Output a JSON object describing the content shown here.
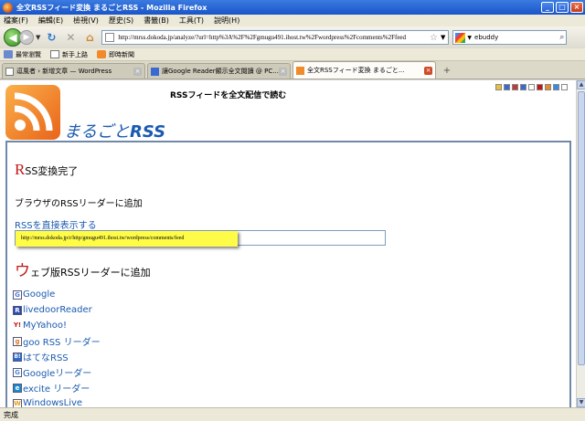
{
  "window": {
    "title": "全文RSSフィード変換 まるごとRSS - Mozilla Firefox",
    "minimize": "_",
    "maximize": "□",
    "close": "×"
  },
  "menu": [
    "檔案(F)",
    "編輯(E)",
    "檢視(V)",
    "歷史(S)",
    "書籤(B)",
    "工具(T)",
    "說明(H)"
  ],
  "nav": {
    "url": "http://mrss.dokoda.jp/analyze/?url=http%3A%2F%2Fgmugu491.ihost.tw%2Fwordpress%2Fcomments%2Ffeed",
    "search_value": "ebuddy"
  },
  "bookmarks": [
    "最常瀏覽",
    "新手上路",
    "即時新聞"
  ],
  "tabs": [
    {
      "label": "逗風者 › 新增文章 — WordPress",
      "active": false
    },
    {
      "label": "讓Google Reader顯示全文閱讀 @ PC...",
      "active": false
    },
    {
      "label": "全文RSSフィード変換 まるごと...",
      "active": true
    }
  ],
  "page": {
    "tagline": "RSSフィードを全文配信で読む",
    "site_name_ja": "まるごと",
    "site_name_en": "RSS",
    "heading1_cap": "R",
    "heading1_rest": "SS変換完了",
    "browser_add": "ブラウザのRSSリーダーに追加",
    "direct_link": "RSSを直接表示する",
    "feed_url": "http://mrss.dokoda.jp/r/http/gmugu491.ihost.tw/wordpress/comments/feed",
    "heading2_cap": "ウ",
    "heading2_rest": "ェブ版RSSリーダーに追加",
    "readers": [
      {
        "name": "Google",
        "icon": "G",
        "color": "#4a7ae0"
      },
      {
        "name": "livedoorReader",
        "icon": "R",
        "color": "#2a4ab0"
      },
      {
        "name": "MyYahoo!",
        "icon": "Y!",
        "color": "#c01818"
      },
      {
        "name": "goo RSS リーダー",
        "icon": "g",
        "color": "#e07a1a"
      },
      {
        "name": "はてなRSS",
        "icon": "B!",
        "color": "#2a6ad0"
      },
      {
        "name": "Googleリーダー",
        "icon": "G",
        "color": "#4a8ae0"
      },
      {
        "name": "excite リーダー",
        "icon": "e",
        "color": "#1a8ad0"
      },
      {
        "name": "WindowsLive",
        "icon": "W",
        "color": "#e0a01a"
      }
    ]
  },
  "status": "完成"
}
